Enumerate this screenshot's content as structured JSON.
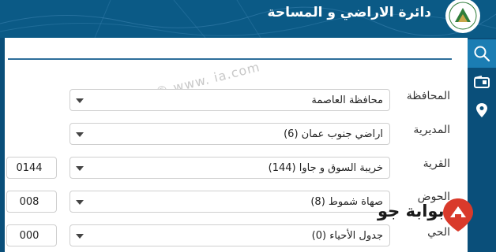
{
  "header": {
    "title": "دائرة الاراضي و المساحة",
    "logo_icon": "department-logo-icon"
  },
  "sidebar": {
    "items": [
      {
        "name": "search",
        "icon": "search-icon"
      },
      {
        "name": "card",
        "icon": "id-card-icon"
      },
      {
        "name": "location",
        "icon": "location-pin-icon"
      }
    ]
  },
  "watermark": {
    "text": "© www.          ia.com"
  },
  "form": {
    "governorate": {
      "label": "المحافظة",
      "value": "محافظة العاصمة"
    },
    "directorate": {
      "label": "المديرية",
      "value": "اراضي جنوب عمان (6)"
    },
    "village": {
      "label": "القرية",
      "value": "خريبة السوق و جاوا (144)",
      "code": "0144"
    },
    "basin": {
      "label": "الحوض",
      "value": "صهاة شموط (8)",
      "code": "008"
    },
    "district": {
      "label": "الحي",
      "value": "جدول الأحياء (0)",
      "code": "000"
    }
  },
  "brand": {
    "text": "بوابة جو",
    "icon": "map-pin-logo-icon"
  },
  "colors": {
    "header": "#0b5a86",
    "active": "#1b7db3",
    "panel": "#ffffff"
  }
}
